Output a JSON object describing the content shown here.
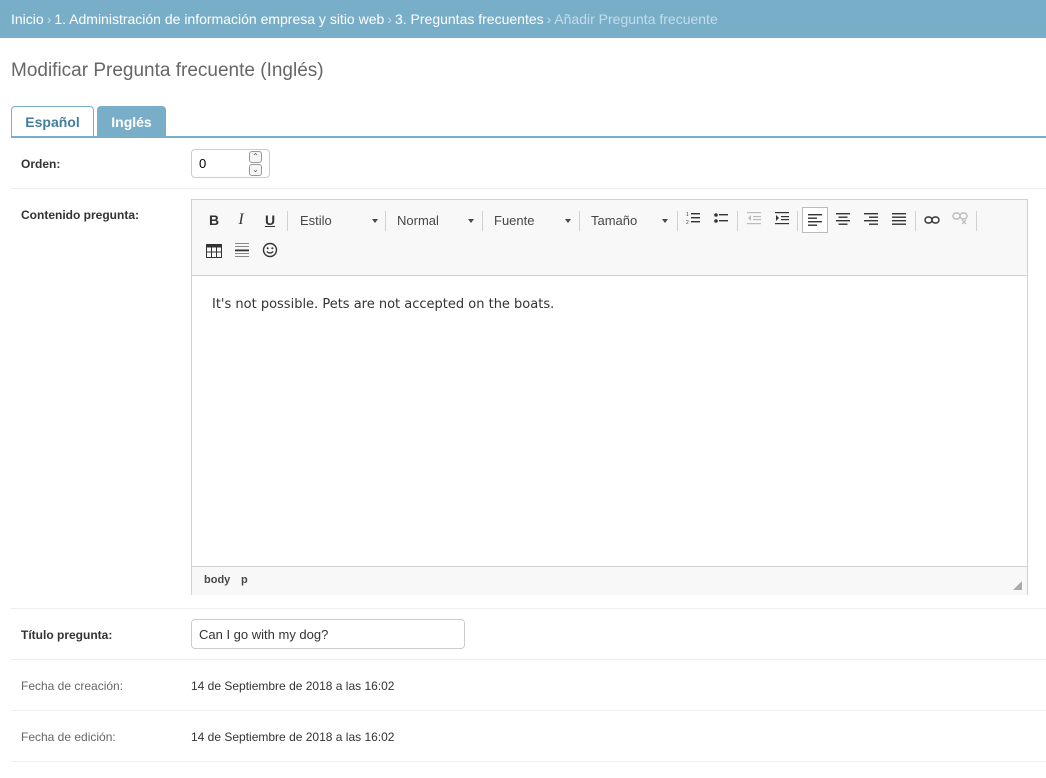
{
  "breadcrumb": {
    "items": [
      "Inicio",
      "1. Administración de información empresa y sitio web",
      "3. Preguntas frecuentes"
    ],
    "current": "Añadir Pregunta frecuente",
    "separator": "›"
  },
  "page_title": "Modificar Pregunta frecuente (Inglés)",
  "tabs": [
    {
      "label": "Español",
      "active": false
    },
    {
      "label": "Inglés",
      "active": true
    }
  ],
  "fields": {
    "orden": {
      "label": "Orden:",
      "value": "0"
    },
    "contenido": {
      "label": "Contenido pregunta:"
    },
    "titulo": {
      "label": "Título pregunta:",
      "value": "Can I go with my dog?"
    },
    "fecha_creacion": {
      "label": "Fecha de creación:",
      "value": "14 de Septiembre de 2018 a las 16:02"
    },
    "fecha_edicion": {
      "label": "Fecha de edición:",
      "value": "14 de Septiembre de 2018 a las 16:02"
    }
  },
  "editor": {
    "toolbar": {
      "bold": "B",
      "italic": "I",
      "underline": "U",
      "style_combo": "Estilo",
      "format_combo": "Normal",
      "font_combo": "Fuente",
      "size_combo": "Tamaño",
      "icons": [
        "bold-icon",
        "italic-icon",
        "underline-icon",
        "numbered-list-icon",
        "bulleted-list-icon",
        "outdent-icon",
        "indent-icon",
        "align-left-icon",
        "align-center-icon",
        "align-right-icon",
        "justify-icon",
        "link-icon",
        "unlink-icon",
        "table-icon",
        "horizontal-line-icon",
        "smiley-icon"
      ]
    },
    "content": "It's not possible. Pets are not accepted on the boats.",
    "path": [
      "body",
      "p"
    ]
  },
  "colors": {
    "header": "#79aec8",
    "tab_active": "#79aec8",
    "tab_text": "#447e9b"
  }
}
